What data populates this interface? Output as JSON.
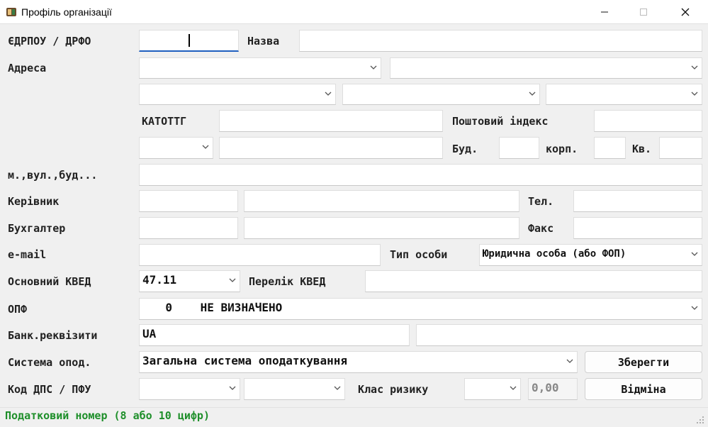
{
  "window": {
    "title": "Профіль організації"
  },
  "labels": {
    "edrpou": "ЄДРПОУ / ДРФО",
    "name": "Назва",
    "address": "Адреса",
    "katottg": "КАТОТТГ",
    "postal_index": "Поштовий індекс",
    "bud": "Буд.",
    "korp": "корп.",
    "kv": "Кв.",
    "street": "м.,вул.,буд...",
    "director": "Керівник",
    "tel": "Тел.",
    "accountant": "Бухгалтер",
    "fax": "Факс",
    "email": "e-mail",
    "person_type": "Тип особи",
    "main_kved": "Основний КВЕД",
    "kved_list": "Перелік КВЕД",
    "opf": "ОПФ",
    "bank": "Банк.реквізити",
    "tax_system": "Система опод.",
    "dps_code": "Код ДПС / ПФУ",
    "risk_class": "Клас ризику"
  },
  "values": {
    "edrpou": "",
    "name": "",
    "person_type": "Юридична особа (або ФОП)",
    "main_kved": "47.11",
    "opf_code": "0",
    "opf_name": "НЕ ВИЗНАЧЕНО",
    "bank_prefix": "UA",
    "tax_system": "Загальна система оподаткування",
    "risk_value": "0,00"
  },
  "buttons": {
    "save": "Зберегти",
    "cancel": "Відміна"
  },
  "status": {
    "text": "Податковий номер (8 або 10 цифр)"
  },
  "colors": {
    "status_text": "#1e8f2a",
    "focus_underline": "#1f5fbf"
  }
}
